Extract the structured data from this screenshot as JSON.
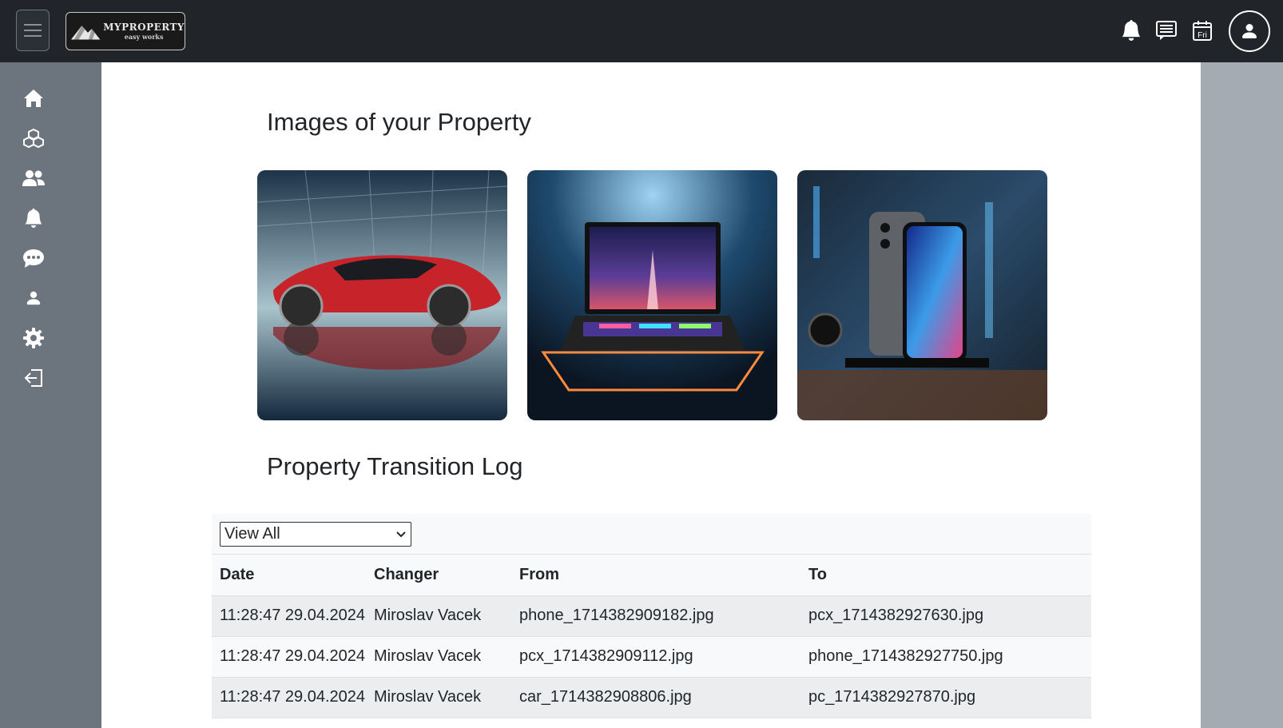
{
  "brand": {
    "title": "MYPROPERTY",
    "subtitle": "easy works"
  },
  "header": {
    "icons": [
      "menu-icon",
      "bell-icon",
      "messages-icon",
      "calendar-icon",
      "user-icon"
    ],
    "calendar_day": "Fri"
  },
  "sidebar": {
    "items": [
      {
        "icon": "home-icon"
      },
      {
        "icon": "boxes-icon"
      },
      {
        "icon": "people-icon"
      },
      {
        "icon": "bell-icon"
      },
      {
        "icon": "chat-icon"
      },
      {
        "icon": "person-icon"
      },
      {
        "icon": "gear-icon"
      },
      {
        "icon": "logout-icon"
      }
    ]
  },
  "gallery": {
    "title": "Images of your Property",
    "images": [
      {
        "icon": "car-image"
      },
      {
        "icon": "laptop-image"
      },
      {
        "icon": "phone-image"
      }
    ]
  },
  "log": {
    "title": "Property Transition Log",
    "filter": {
      "selected": "View All"
    },
    "columns": [
      "Date",
      "Changer",
      "From",
      "To"
    ],
    "rows": [
      {
        "date": "11:28:47 29.04.2024",
        "changer": "Miroslav Vacek",
        "from": "phone_1714382909182.jpg",
        "to": "pcx_1714382927630.jpg"
      },
      {
        "date": "11:28:47 29.04.2024",
        "changer": "Miroslav Vacek",
        "from": "pcx_1714382909112.jpg",
        "to": "phone_1714382927750.jpg"
      },
      {
        "date": "11:28:47 29.04.2024",
        "changer": "Miroslav Vacek",
        "from": "car_1714382908806.jpg",
        "to": "pc_1714382927870.jpg"
      }
    ]
  },
  "colors": {
    "topbar": "#212529",
    "sidebar": "#6c757d",
    "background": "#a5abb3",
    "main": "#ffffff"
  }
}
